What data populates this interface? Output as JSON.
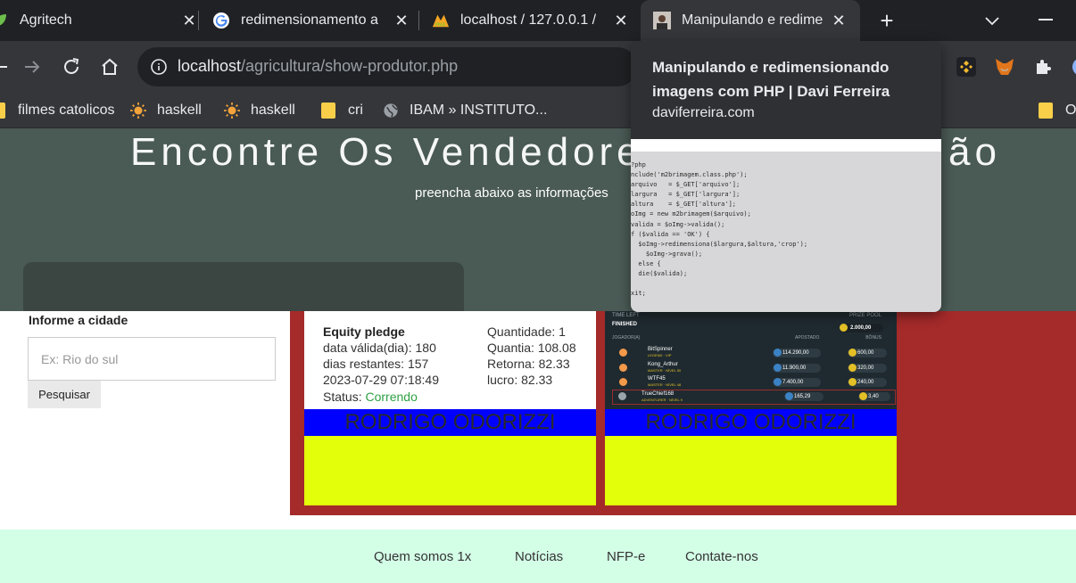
{
  "browser": {
    "tabs": [
      {
        "title": "Agritech",
        "favicon": "leaf-icon",
        "active": false
      },
      {
        "title": "redimensionamento a",
        "favicon": "google-icon",
        "active": false
      },
      {
        "title": "localhost / 127.0.0.1 /",
        "favicon": "phpmyadmin-icon",
        "active": false
      },
      {
        "title": "Manipulando e redime",
        "favicon": "avatar-icon",
        "active": true
      }
    ],
    "url_host": "localhost",
    "url_path": "/agricultura/show-produtor.php",
    "bookmarks": [
      {
        "label": "filmes catolicos",
        "icon": "folder-icon"
      },
      {
        "label": "haskell",
        "icon": "sun-icon"
      },
      {
        "label": "haskell",
        "icon": "sun-icon"
      },
      {
        "label": "cri",
        "icon": "folder-icon"
      },
      {
        "label": "IBAM » INSTITUTO...",
        "icon": "globe-icon"
      },
      {
        "label": "O",
        "icon": "folder-icon"
      }
    ],
    "tooltip": {
      "title": "Manipulando e redimensionando imagens com PHP | Davi Ferreira",
      "domain": "daviferreira.com",
      "code_lines": [
        "?php",
        "nclude('m2brimagem.class.php');",
        "arquivo   = $_GET['arquivo'];",
        "largura   = $_GET['largura'];",
        "altura    = $_GET['altura'];",
        "oImg = new m2brimagem($arquivo);",
        "valida = $oImg->valida();",
        "f ($valida == 'OK') {",
        "  $oImg->redimensiona($largura,$altura,'crop');",
        "    $oImg->grava();",
        "  else {",
        "  die($valida);",
        "",
        "xit;"
      ]
    }
  },
  "page": {
    "hero_title": "Encontre Os Vendedore",
    "hero_title_tail": "ão",
    "hero_subtitle": "preencha abaixo as informações",
    "search_label": "Informe a cidade",
    "search_placeholder": "Ex: Rio do sul",
    "search_button": "Pesquisar",
    "cards": [
      {
        "name": "RODRIGO ODORIZZI",
        "equity_title": "Equity pledge",
        "left_lines": [
          "data válida(dia): 180",
          "dias restantes: 157",
          "2023-07-29 07:18:49"
        ],
        "status_label": "Status:",
        "status_value": "Correndo",
        "right_lines": [
          "Quantidade: 1",
          "Quantia: 108.08",
          "Retorna: 82.33",
          "lucro: 82.33"
        ]
      },
      {
        "name": "RODRIGO ODORIZZI",
        "game": {
          "time_left": "TIME LEFT",
          "prize_pool": "PRIZE POOL",
          "finished": "FINISHED",
          "prize": "2.000,00",
          "col_player": "JOGADOR(A)",
          "col_bet": "APOSTADO",
          "col_bonus": "BÔNUS",
          "rows": [
            {
              "player": "BitSpinner",
              "tag": "LEGEND · VIP",
              "bet": "114.290,00",
              "bonus": "600,00"
            },
            {
              "player": "Kong_Arthur",
              "tag": "MASTER · NÍVEL 50",
              "bet": "11.900,00",
              "bonus": "320,00"
            },
            {
              "player": "WTF45",
              "tag": "MASTER · NÍVEL 48",
              "bet": "7.400,00",
              "bonus": "240,00"
            },
            {
              "player": "TrueChief168",
              "tag": "ADVENTURER · NÍVEL 9",
              "bet": "165,29",
              "bonus": "3,40"
            }
          ]
        }
      }
    ],
    "footer_links": [
      "Quem somos 1x",
      "Notícias",
      "NFP-e",
      "Contate-nos"
    ]
  },
  "colors": {
    "results_bg": "#a52a2a",
    "card_name_bg": "#0000ff",
    "card_bottom_bg": "#e4ff0a",
    "footer_bg": "#d4ffe7",
    "status_running": "#2ea043"
  }
}
